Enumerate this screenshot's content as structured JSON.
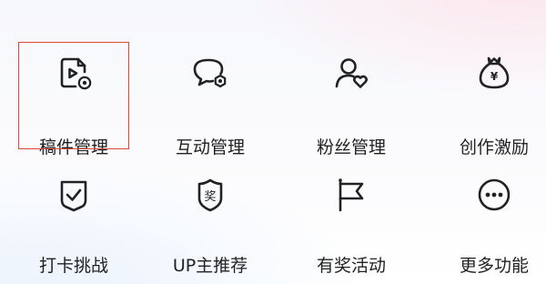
{
  "menu": {
    "items": [
      {
        "label": "稿件管理",
        "icon": "manuscript-file-icon",
        "selected": true
      },
      {
        "label": "互动管理",
        "icon": "chat-bubble-gear-icon",
        "selected": false
      },
      {
        "label": "粉丝管理",
        "icon": "user-heart-icon",
        "selected": false
      },
      {
        "label": "创作激励",
        "icon": "money-bag-yen-icon",
        "selected": false
      },
      {
        "label": "打卡挑战",
        "icon": "shield-check-icon",
        "selected": false
      },
      {
        "label": "UP主推荐",
        "icon": "award-badge-icon",
        "selected": false
      },
      {
        "label": "有奖活动",
        "icon": "flag-icon",
        "selected": false
      },
      {
        "label": "更多功能",
        "icon": "more-dots-icon",
        "selected": false
      }
    ],
    "badge_text": "奖",
    "money_symbol": "¥"
  },
  "highlight_color": "#e0463a"
}
